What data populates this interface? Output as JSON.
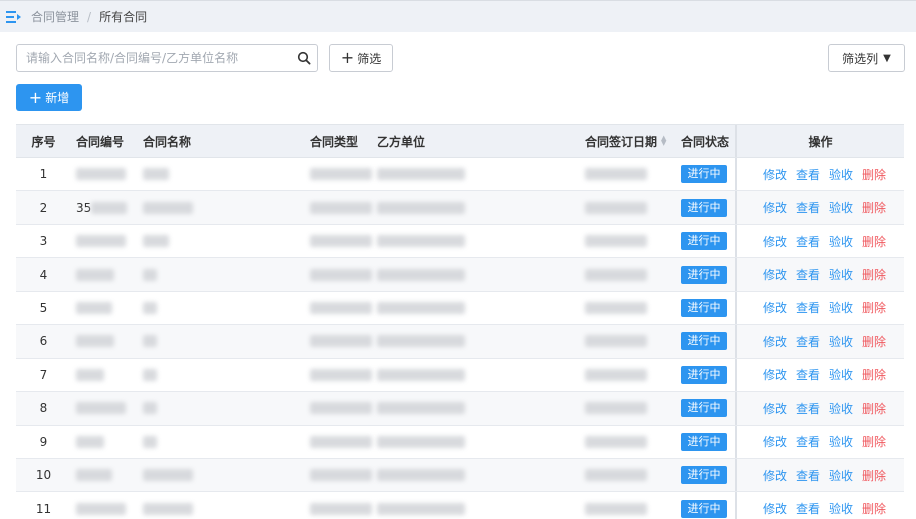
{
  "breadcrumb": {
    "parent": "合同管理",
    "separator": "/",
    "current": "所有合同"
  },
  "search": {
    "placeholder": "请输入合同名称/合同编号/乙方单位名称",
    "value": ""
  },
  "toolbar": {
    "filter_label": "筛选",
    "filter_columns_label": "筛选列",
    "add_label": "新增"
  },
  "table": {
    "headers": {
      "no": "序号",
      "code": "合同编号",
      "name": "合同名称",
      "type": "合同类型",
      "party": "乙方单位",
      "date": "合同签订日期",
      "status": "合同状态",
      "ops": "操作"
    },
    "actions": {
      "edit": "修改",
      "view": "查看",
      "accept": "验收",
      "delete": "删除"
    },
    "rows": [
      {
        "no": "1",
        "code": "",
        "status": "进行中"
      },
      {
        "no": "2",
        "code": "35",
        "status": "进行中"
      },
      {
        "no": "3",
        "code": "",
        "status": "进行中"
      },
      {
        "no": "4",
        "code": "",
        "status": "进行中"
      },
      {
        "no": "5",
        "code": "",
        "status": "进行中"
      },
      {
        "no": "6",
        "code": "",
        "status": "进行中"
      },
      {
        "no": "7",
        "code": "",
        "status": "进行中"
      },
      {
        "no": "8",
        "code": "",
        "status": "进行中"
      },
      {
        "no": "9",
        "code": "",
        "status": "进行中"
      },
      {
        "no": "10",
        "code": "",
        "status": "进行中"
      },
      {
        "no": "11",
        "code": "",
        "status": "进行中"
      }
    ]
  },
  "colors": {
    "primary": "#2d95f0",
    "danger": "#f0585e",
    "header_bg": "#eef1f6"
  },
  "icons": {
    "menu": "menu-toggle-icon",
    "search": "search-icon",
    "plus": "plus-icon",
    "caret": "caret-down-icon",
    "sort": "sort-icon"
  }
}
